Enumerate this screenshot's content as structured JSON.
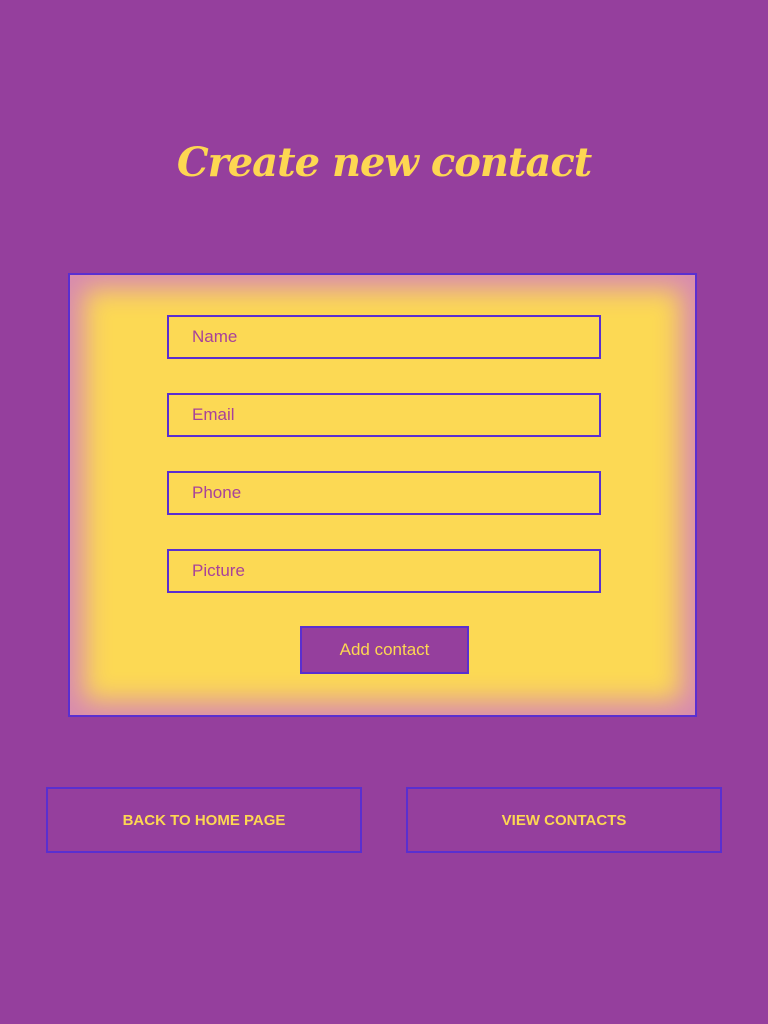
{
  "page": {
    "title": "Create new contact"
  },
  "form": {
    "fields": [
      {
        "placeholder": "Name",
        "value": ""
      },
      {
        "placeholder": "Email",
        "value": ""
      },
      {
        "placeholder": "Phone",
        "value": ""
      },
      {
        "placeholder": "Picture",
        "value": ""
      }
    ],
    "submit_label": "Add contact"
  },
  "nav": {
    "home_label": "BACK TO HOME PAGE",
    "contacts_label": "VIEW CONTACTS"
  },
  "colors": {
    "background": "#953f9d",
    "accent": "#fdd752",
    "border": "#5a2fd0",
    "placeholder": "#a8429a"
  }
}
